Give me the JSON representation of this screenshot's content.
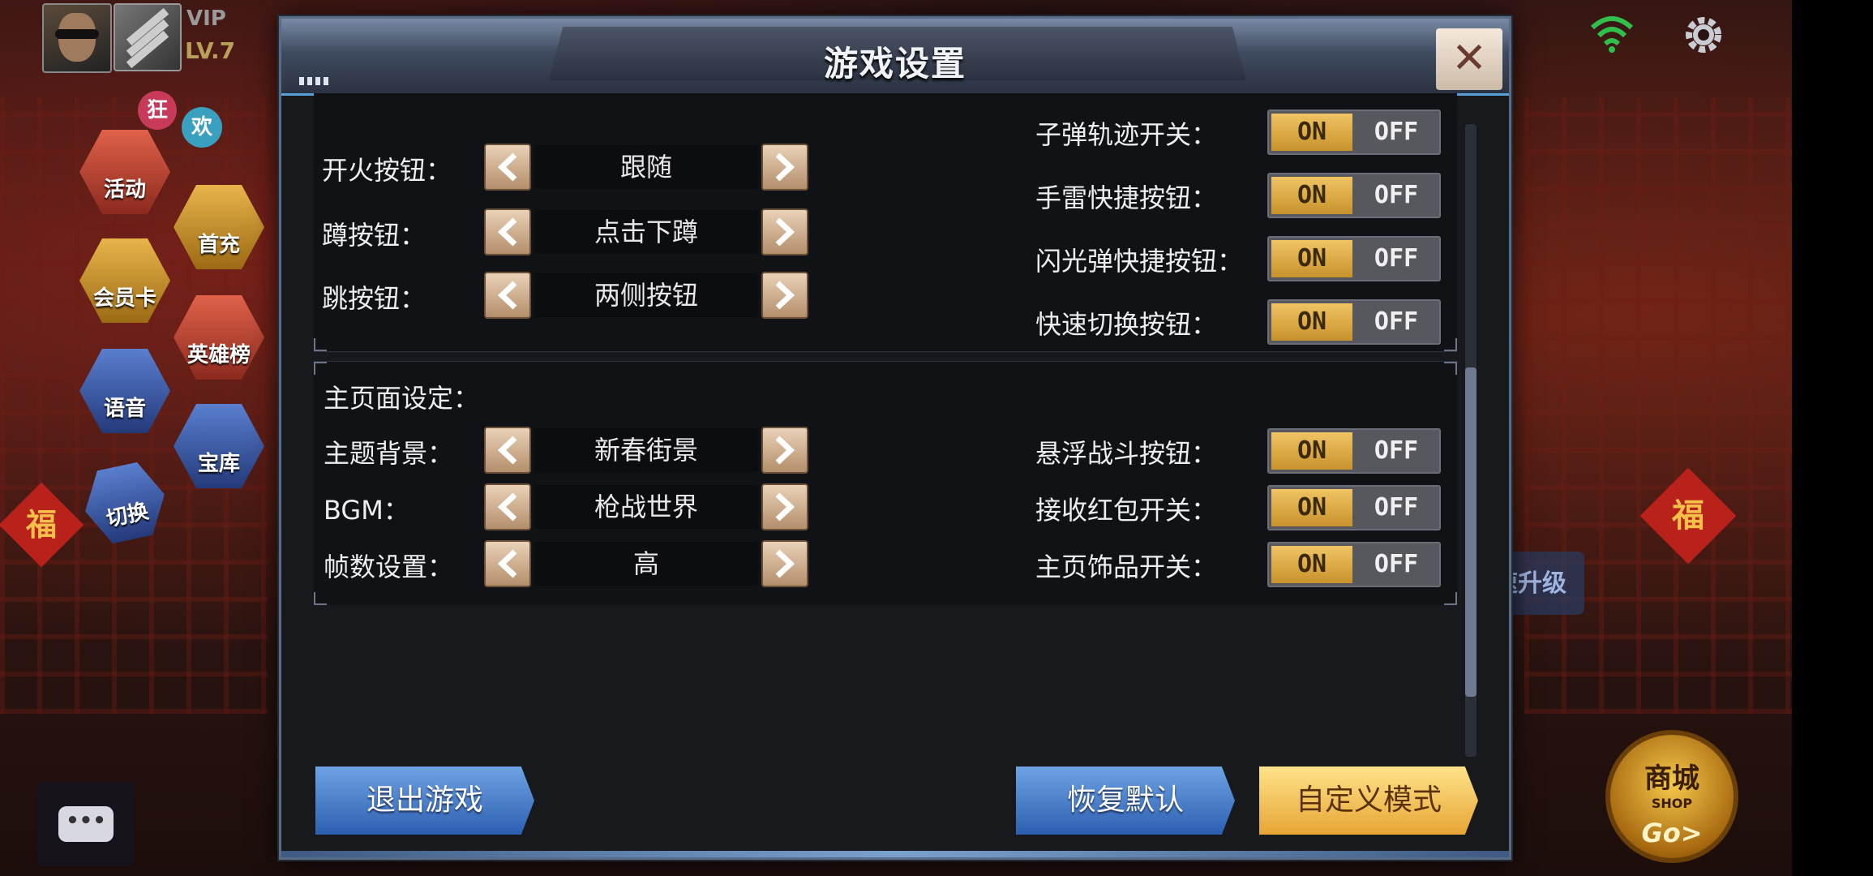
{
  "hud": {
    "vip_label": "VIP",
    "level_label": "LV.7"
  },
  "side_menu": {
    "bubble_left": "狂",
    "bubble_right": "欢",
    "events": "活动",
    "topup": "首充",
    "member": "会员卡",
    "heroes": "英雄榜",
    "voice": "语音",
    "vault": "宝库",
    "switch": "切换"
  },
  "decor": {
    "fu_left": "福",
    "fu_right": "福",
    "level_up_text": "速升级"
  },
  "shop": {
    "title": "商城",
    "subtitle": "SHOP",
    "go": "Go>"
  },
  "dialog": {
    "title": "游戏设置",
    "close_symbol": "✕",
    "controls": [
      {
        "label": "开火按钮：",
        "value": "跟随"
      },
      {
        "label": "蹲按钮：",
        "value": "点击下蹲"
      },
      {
        "label": "跳按钮：",
        "value": "两侧按钮"
      }
    ],
    "control_toggles": [
      {
        "label": "子弹轨迹开关：",
        "on": "ON",
        "off": "OFF",
        "state": "on"
      },
      {
        "label": "手雷快捷按钮：",
        "on": "ON",
        "off": "OFF",
        "state": "on"
      },
      {
        "label": "闪光弹快捷按钮：",
        "on": "ON",
        "off": "OFF",
        "state": "on"
      },
      {
        "label": "快速切换按钮：",
        "on": "ON",
        "off": "OFF",
        "state": "on"
      }
    ],
    "home_section_title": "主页面设定：",
    "home_settings": [
      {
        "label": "主题背景：",
        "value": "新春街景"
      },
      {
        "label": "BGM：",
        "value": "枪战世界"
      },
      {
        "label": "帧数设置：",
        "value": "高"
      }
    ],
    "home_toggles": [
      {
        "label": "悬浮战斗按钮：",
        "on": "ON",
        "off": "OFF",
        "state": "on"
      },
      {
        "label": "接收红包开关：",
        "on": "ON",
        "off": "OFF",
        "state": "on"
      },
      {
        "label": "主页饰品开关：",
        "on": "ON",
        "off": "OFF",
        "state": "on"
      }
    ],
    "buttons": {
      "quit": "退出游戏",
      "restore": "恢复默认",
      "custom": "自定义模式"
    }
  },
  "icons": {
    "close": "close-icon",
    "arrow_left": "chevron-left-icon",
    "arrow_right": "chevron-right-icon",
    "wifi": "wifi-icon",
    "settings": "gear-icon",
    "chat": "chat-icon"
  },
  "colors": {
    "toggle_on": "#e8b44a",
    "primary_button": "#3f78c8",
    "accent_button": "#f2c452",
    "dialog_bg": "#17191d"
  }
}
